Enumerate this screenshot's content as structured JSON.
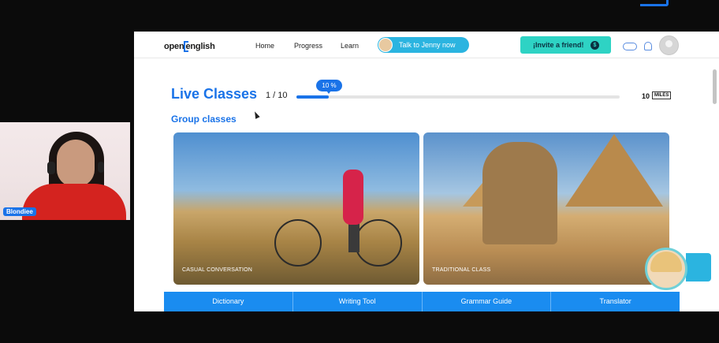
{
  "participant": {
    "name": "Blondiee"
  },
  "app": {
    "logo": {
      "part1": "open",
      "part2": "english"
    },
    "nav": {
      "home": "Home",
      "progress": "Progress",
      "learn": "Learn"
    },
    "talk_button": "Talk to Jenny now",
    "invite_button": "¡Invite a friend!",
    "invite_icon": "$"
  },
  "live_classes": {
    "title": "Live Classes",
    "counter": "1 / 10",
    "progress_percent": 10,
    "progress_label": "10 %",
    "miles_value": "10",
    "miles_unit": "MILES",
    "group_title": "Group classes",
    "cards": [
      {
        "caption": "CASUAL CONVERSATION"
      },
      {
        "caption": "TRADITIONAL CLASS"
      }
    ]
  },
  "tools": [
    "Dictionary",
    "Writing Tool",
    "Grammar Guide",
    "Translator"
  ],
  "colors": {
    "brand_blue": "#1a73e8",
    "invite_teal": "#2ed3c4",
    "tools_blue": "#1a8cf0",
    "cam_shirt": "#d4231f"
  }
}
